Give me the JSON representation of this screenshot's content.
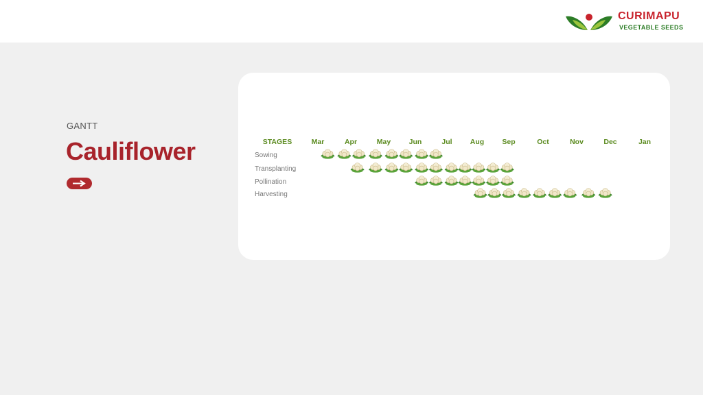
{
  "header": {
    "brand_name": "CURIMAPU",
    "brand_tagline": "VEGETABLE SEEDS"
  },
  "sidebar": {
    "eyebrow": "GANTT",
    "title": "Cauliflower"
  },
  "colors": {
    "brand_red": "#c8232c",
    "title_red": "#a8232b",
    "brand_green": "#2d7d27",
    "header_green": "#5a8a1e",
    "background": "#f0f0f0",
    "card": "#ffffff"
  },
  "icons": {
    "next": "arrow-right-icon",
    "marker": "cauliflower-icon"
  },
  "chart_data": {
    "type": "gantt",
    "stage_header": "STAGES",
    "months": [
      "Mar",
      "Apr",
      "May",
      "Jun",
      "Jul",
      "Aug",
      "Sep",
      "Oct",
      "Nov",
      "Dec",
      "Jan"
    ],
    "stages": [
      {
        "name": "Sowing",
        "months": [
          0.3,
          0.8,
          1.25,
          1.75,
          2.25,
          2.7,
          3.2,
          3.65
        ]
      },
      {
        "name": "Transplanting",
        "months": [
          1.2,
          1.75,
          2.25,
          2.7,
          3.2,
          3.65,
          4.15,
          4.6,
          5.05,
          5.5,
          5.95
        ]
      },
      {
        "name": "Pollination",
        "months": [
          3.2,
          3.65,
          4.15,
          4.6,
          5.05,
          5.5,
          5.95
        ]
      },
      {
        "name": "Harvesting",
        "months": [
          5.1,
          5.55,
          6.0,
          6.45,
          6.9,
          7.35,
          7.8,
          8.35,
          8.85
        ]
      }
    ]
  }
}
